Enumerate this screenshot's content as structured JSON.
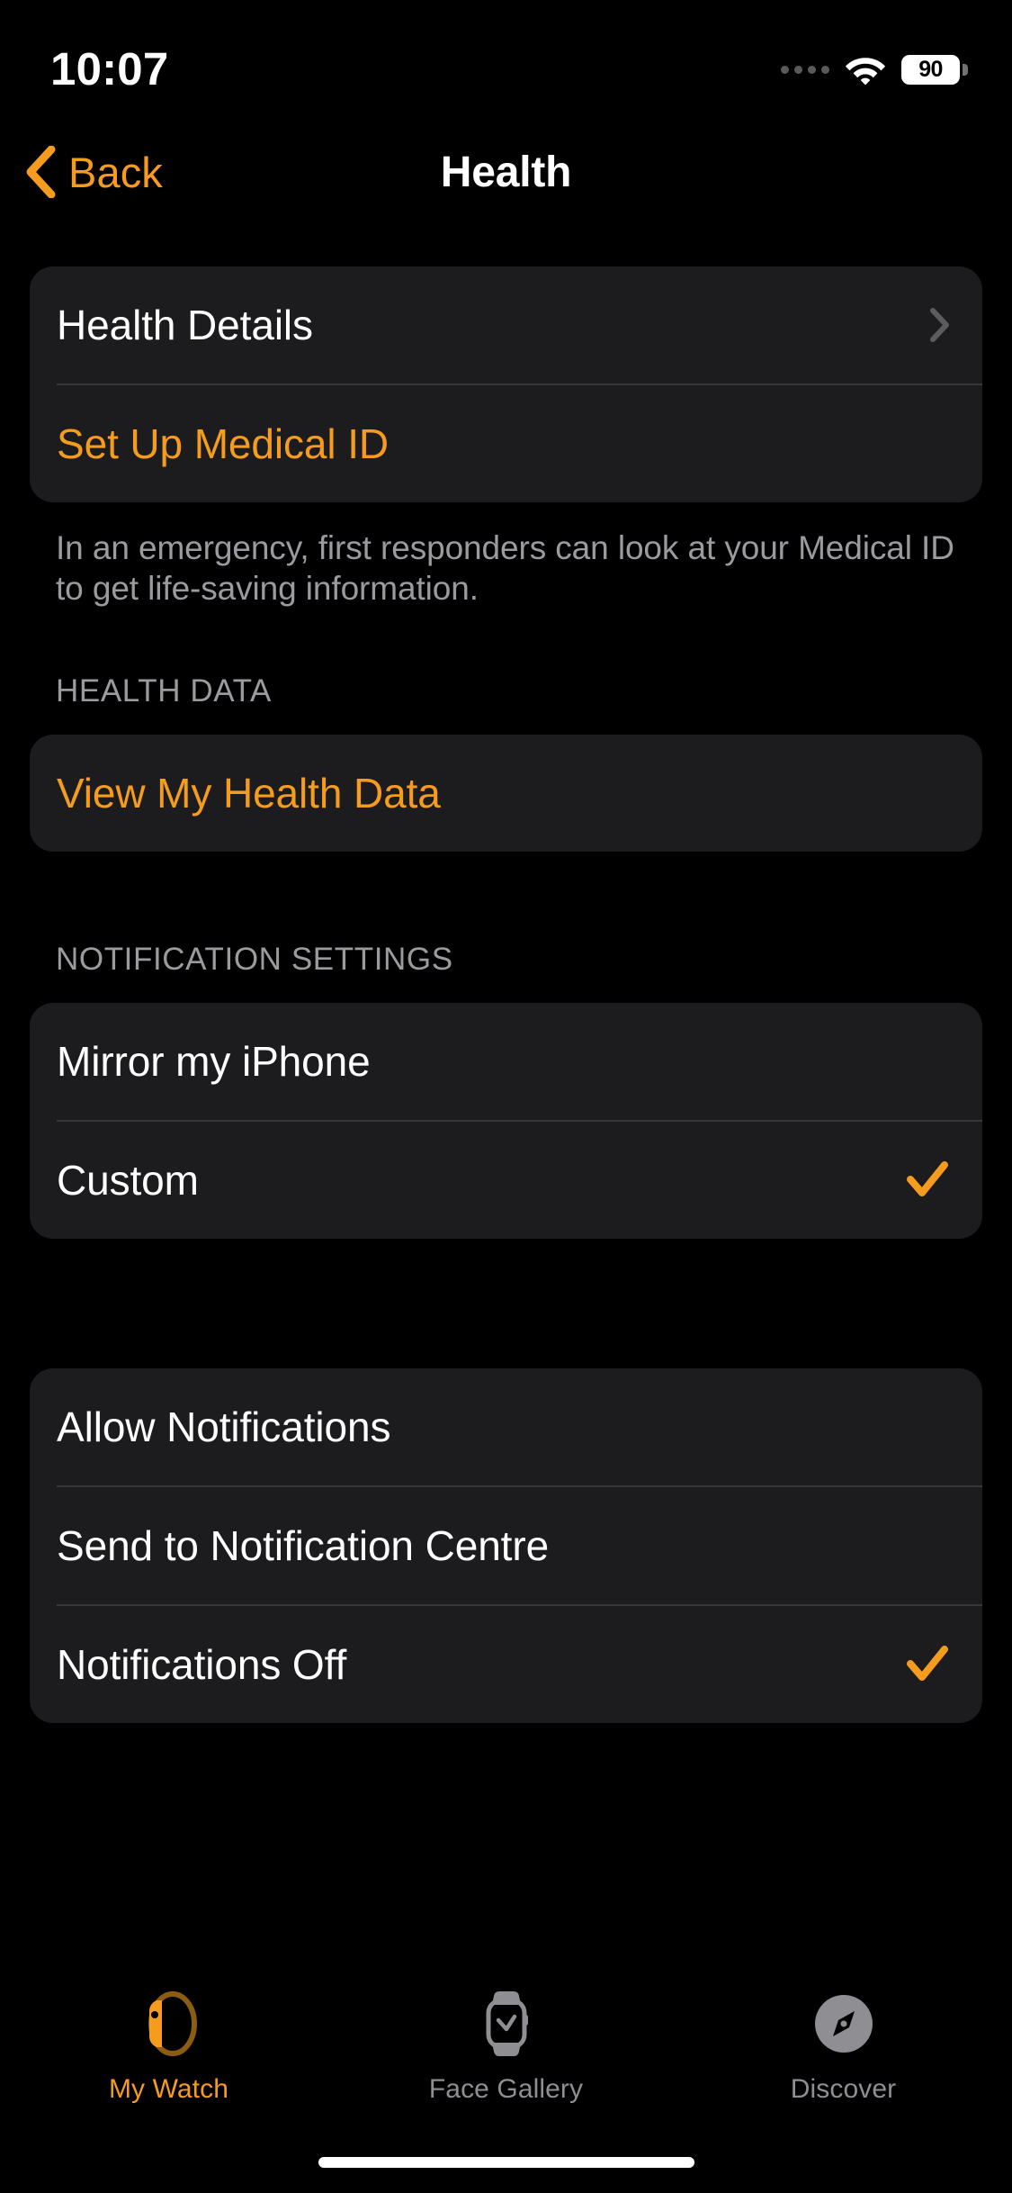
{
  "status_bar": {
    "time": "10:07",
    "battery_level": "90",
    "signal_icon": "signal-dots-icon",
    "wifi_icon": "wifi-icon",
    "battery_icon": "battery-icon"
  },
  "nav": {
    "back_label": "Back",
    "back_icon": "chevron-left-icon",
    "title": "Health"
  },
  "sections": {
    "details_card": {
      "rows": [
        {
          "label": "Health Details",
          "style": "default",
          "accessory": "chevron-right-icon"
        },
        {
          "label": "Set Up Medical ID",
          "style": "accent",
          "accessory": "none"
        }
      ]
    },
    "medical_id_footnote": "In an emergency, first responders can look at your Medical ID to get life-saving information.",
    "health_data": {
      "header": "HEALTH DATA",
      "rows": [
        {
          "label": "View My Health Data",
          "style": "accent",
          "accessory": "none"
        }
      ]
    },
    "notification_settings": {
      "header": "NOTIFICATION SETTINGS",
      "rows": [
        {
          "label": "Mirror my iPhone",
          "style": "default",
          "accessory": "none"
        },
        {
          "label": "Custom",
          "style": "default",
          "accessory": "checkmark-icon"
        }
      ]
    },
    "notification_options": {
      "rows": [
        {
          "label": "Allow Notifications",
          "style": "default",
          "accessory": "none"
        },
        {
          "label": "Send to Notification Centre",
          "style": "default",
          "accessory": "none"
        },
        {
          "label": "Notifications Off",
          "style": "default",
          "accessory": "checkmark-icon"
        }
      ]
    }
  },
  "tab_bar": {
    "items": [
      {
        "label": "My Watch",
        "icon": "watch-side-icon",
        "active": true
      },
      {
        "label": "Face Gallery",
        "icon": "watch-face-icon",
        "active": false
      },
      {
        "label": "Discover",
        "icon": "compass-icon",
        "active": false
      }
    ]
  },
  "colors": {
    "accent": "#f59c1f",
    "card_background": "#1c1c1e",
    "page_background": "#000000",
    "secondary_text": "#9b9b9f",
    "divider": "#38383a",
    "tab_inactive": "#8e8e93"
  }
}
